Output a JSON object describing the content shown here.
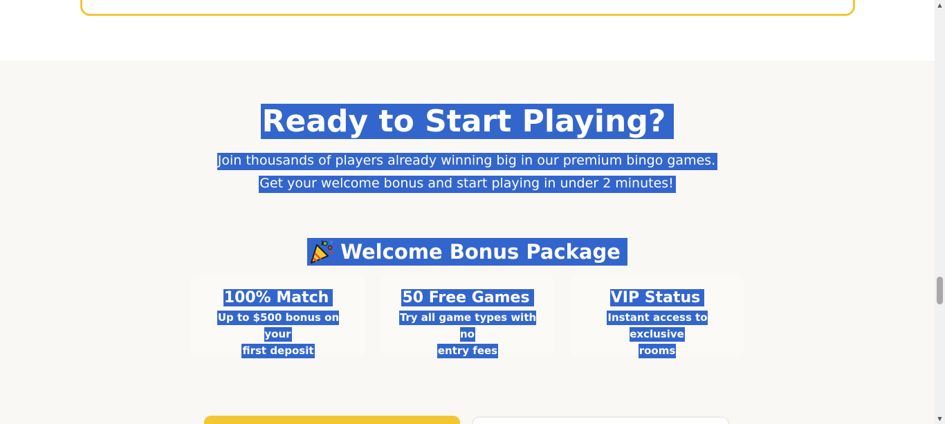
{
  "cta": {
    "headline": "Ready to Start Playing?",
    "lead_line1": "Join thousands of players already winning big in our premium bingo games.",
    "lead_line2": "Get your welcome bonus and start playing in under 2 minutes!"
  },
  "bonus": {
    "icon": "party-popper-icon",
    "title": "Welcome Bonus Package",
    "cards": [
      {
        "title": "100% Match",
        "desc_line1": "Up to $500 bonus on your",
        "desc_line2": "first deposit"
      },
      {
        "title": "50 Free Games",
        "desc_line1": "Try all game types with no",
        "desc_line2": "entry fees"
      },
      {
        "title": "VIP Status",
        "desc_line1": "Instant access to exclusive",
        "desc_line2": "rooms"
      }
    ]
  },
  "colors": {
    "selection": "#3366cc",
    "accent_yellow": "#f5c634",
    "section_bg": "#faf8f4"
  }
}
